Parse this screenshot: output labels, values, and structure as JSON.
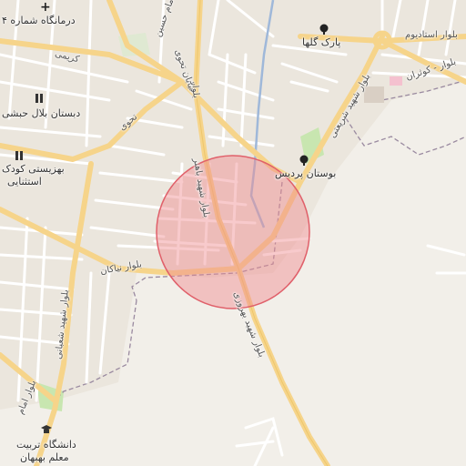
{
  "map": {
    "labels": {
      "clinic": "درمانگاه شماره ۴",
      "school": "دبستان بلال حبشی",
      "kindergarten_1": "بهزیستی کودک",
      "kindergarten_2": "استثنایی",
      "park_golha": "پارک گلها",
      "park_pardis": "بوستان پردیس",
      "stadium_blvd": "بلوار استادیوم",
      "kosaran_blvd": "بلوار - کوثران",
      "university_1": "دانشگاه تربیت",
      "university_2": "معلم بهبهان",
      "neyakan_blvd": "بلوار نیاکان",
      "bahonar_blvd": "بلوار شهید باهنر",
      "behrouzi_blvd": "بلوار شهید بهروزی",
      "shabani_blvd": "بلوار شهید شعبانی",
      "shariati_blvd": "بلوار شهید شریعتی",
      "imam_blvd": "بلوار امام",
      "khayaban_tavi": "خیابان تحوی",
      "street_karimi": "کریمی",
      "street_tavi": "تحوی",
      "boulevard_1": "بلوار",
      "imam_hossein": "امام حسین"
    },
    "colors": {
      "background": "#f2efe9",
      "major_road": "#f6d48a",
      "minor_road": "#ffffff",
      "park": "#c8e6b0",
      "water": "#9fb8d9",
      "boundary": "#9a8aa0",
      "highlight_fill": "#f08a8e",
      "highlight_stroke": "#e0606a"
    },
    "highlight": {
      "shape": "circle"
    }
  }
}
